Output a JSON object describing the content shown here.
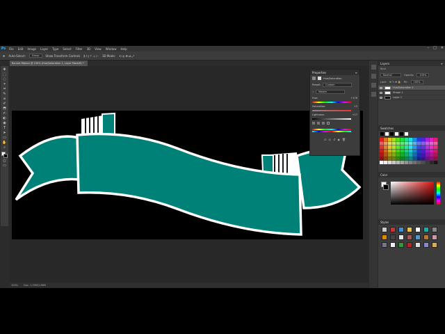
{
  "app": {
    "logo": "Ps",
    "menu": [
      "File",
      "Edit",
      "Image",
      "Layer",
      "Type",
      "Select",
      "Filter",
      "3D",
      "View",
      "Window",
      "Help"
    ],
    "window_controls": [
      "–",
      "□",
      "✕"
    ]
  },
  "options_bar": {
    "auto_select_label": "Auto-Select:",
    "auto_select_value": "Group",
    "show_transform_label": "Show Transform Controls",
    "mode_label": "3D Mode:"
  },
  "document": {
    "tab_title": "Banner-Ribbon @ 100% (Hue/Saturation 1, Layer Mask/8) *",
    "zoom": "100%",
    "doc_size": "Doc: 1.39M/1.86M"
  },
  "tools": [
    "✥",
    "⬚",
    "◌",
    "⌖",
    "⌗",
    "✎",
    "⌀",
    "✐",
    "⬒",
    "✍",
    "◐",
    "◉",
    "T",
    "➤",
    "▭",
    "✋",
    "⌕",
    "■"
  ],
  "properties": {
    "title": "Properties",
    "adjustment": "Hue/Saturation",
    "preset_label": "Preset:",
    "preset_value": "Custom",
    "channel_value": "Master",
    "hue_label": "Hue:",
    "hue_value": "+176",
    "saturation_label": "Saturation:",
    "saturation_value": "+3",
    "lightness_label": "Lightness:",
    "lightness_value": "+17"
  },
  "layers": {
    "title": "Layers",
    "kind_label": "Kind",
    "blend_mode": "Normal",
    "opacity_label": "Opacity:",
    "opacity_value": "100%",
    "lock_label": "Lock:",
    "fill_label": "Fill:",
    "fill_value": "100%",
    "rows": [
      {
        "name": "Hue/Saturation 1",
        "selected": true,
        "thumb": "white"
      },
      {
        "name": "Shape 1",
        "selected": false,
        "thumb": "white"
      },
      {
        "name": "Layer 1",
        "selected": false,
        "thumb": "dark"
      }
    ]
  },
  "swatches": {
    "title": "Swatches"
  },
  "color": {
    "title": "Color"
  },
  "styles": {
    "title": "Styles"
  },
  "colors": {
    "ribbon": "#008177",
    "ribbon_outline": "#ffffff",
    "accent": "#31a8ff"
  }
}
